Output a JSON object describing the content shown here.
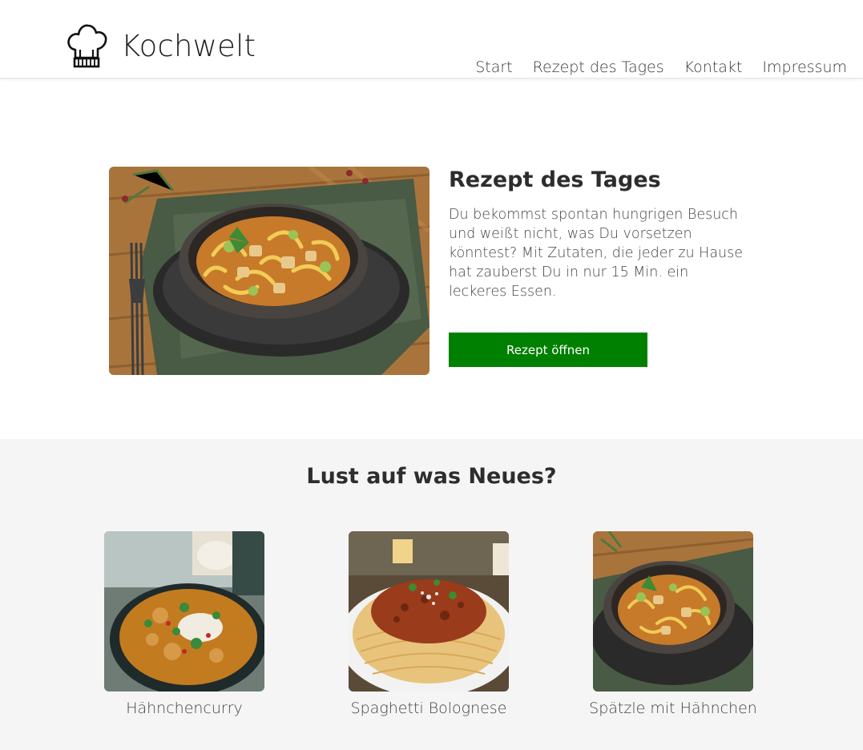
{
  "header": {
    "logo_text": "Kochwelt",
    "logo_icon": "chef-hat-icon",
    "nav": [
      "Start",
      "Rezept des Tages",
      "Kontakt",
      "Impressum"
    ]
  },
  "hero": {
    "title": "Rezept des Tages",
    "text": "Du bekommst spontan hungrigen Besuch und weißt nicht, was Du vorsetzen könntest? Mit Zutaten, die jeder zu Hause hat zauberst Du in nur 15 Min. ein leckeres Essen.",
    "button_label": "Rezept öffnen",
    "button_color": "#008000"
  },
  "section": {
    "title": "Lust auf was Neues?",
    "cards": [
      {
        "label": "Hähnchencurry"
      },
      {
        "label": "Spaghetti Bolognese"
      },
      {
        "label": "Spätzle mit Hähnchen"
      }
    ]
  }
}
